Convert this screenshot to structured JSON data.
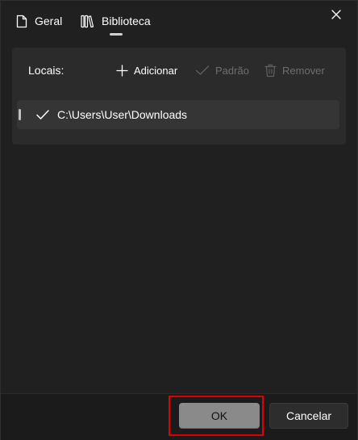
{
  "header": {
    "tabs": [
      {
        "label": "Geral",
        "icon": "document-icon"
      },
      {
        "label": "Biblioteca",
        "icon": "library-icon",
        "selected": true
      }
    ],
    "close_icon": "close-icon"
  },
  "panel": {
    "title": "Locais:",
    "toolbar": {
      "add_label": "Adicionar",
      "default_label": "Padrão",
      "remove_label": "Remover"
    },
    "locations": [
      {
        "path": "C:\\Users\\User\\Downloads",
        "is_default": true
      }
    ]
  },
  "footer": {
    "ok_label": "OK",
    "cancel_label": "Cancelar"
  },
  "colors": {
    "background": "#202020",
    "panel": "#2b2b2b",
    "list_item": "#353535",
    "disabled_text": "#6e6e6e",
    "ok_button": "#8a8a8a",
    "highlight": "#e00000"
  }
}
